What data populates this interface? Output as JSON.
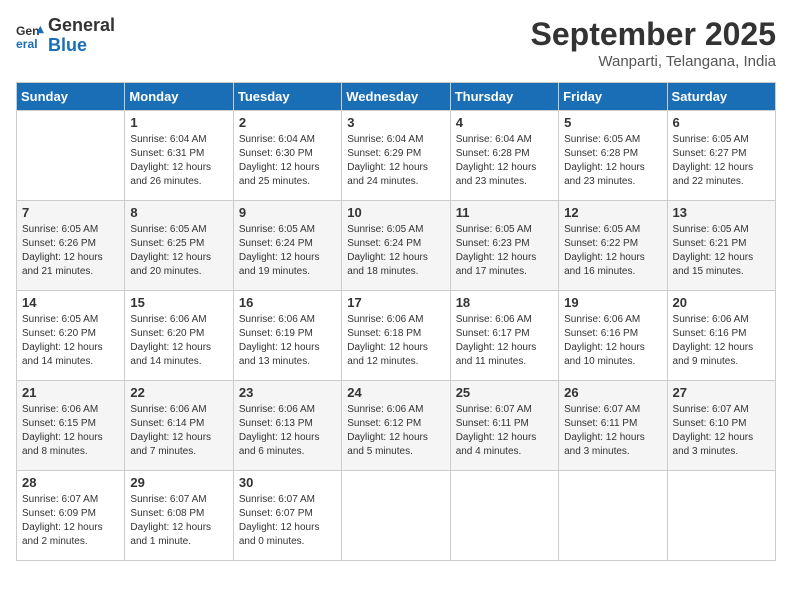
{
  "logo": {
    "line1": "General",
    "line2": "Blue"
  },
  "title": "September 2025",
  "subtitle": "Wanparti, Telangana, India",
  "days_of_week": [
    "Sunday",
    "Monday",
    "Tuesday",
    "Wednesday",
    "Thursday",
    "Friday",
    "Saturday"
  ],
  "weeks": [
    [
      {
        "day": "",
        "info": ""
      },
      {
        "day": "1",
        "info": "Sunrise: 6:04 AM\nSunset: 6:31 PM\nDaylight: 12 hours\nand 26 minutes."
      },
      {
        "day": "2",
        "info": "Sunrise: 6:04 AM\nSunset: 6:30 PM\nDaylight: 12 hours\nand 25 minutes."
      },
      {
        "day": "3",
        "info": "Sunrise: 6:04 AM\nSunset: 6:29 PM\nDaylight: 12 hours\nand 24 minutes."
      },
      {
        "day": "4",
        "info": "Sunrise: 6:04 AM\nSunset: 6:28 PM\nDaylight: 12 hours\nand 23 minutes."
      },
      {
        "day": "5",
        "info": "Sunrise: 6:05 AM\nSunset: 6:28 PM\nDaylight: 12 hours\nand 23 minutes."
      },
      {
        "day": "6",
        "info": "Sunrise: 6:05 AM\nSunset: 6:27 PM\nDaylight: 12 hours\nand 22 minutes."
      }
    ],
    [
      {
        "day": "7",
        "info": "Sunrise: 6:05 AM\nSunset: 6:26 PM\nDaylight: 12 hours\nand 21 minutes."
      },
      {
        "day": "8",
        "info": "Sunrise: 6:05 AM\nSunset: 6:25 PM\nDaylight: 12 hours\nand 20 minutes."
      },
      {
        "day": "9",
        "info": "Sunrise: 6:05 AM\nSunset: 6:24 PM\nDaylight: 12 hours\nand 19 minutes."
      },
      {
        "day": "10",
        "info": "Sunrise: 6:05 AM\nSunset: 6:24 PM\nDaylight: 12 hours\nand 18 minutes."
      },
      {
        "day": "11",
        "info": "Sunrise: 6:05 AM\nSunset: 6:23 PM\nDaylight: 12 hours\nand 17 minutes."
      },
      {
        "day": "12",
        "info": "Sunrise: 6:05 AM\nSunset: 6:22 PM\nDaylight: 12 hours\nand 16 minutes."
      },
      {
        "day": "13",
        "info": "Sunrise: 6:05 AM\nSunset: 6:21 PM\nDaylight: 12 hours\nand 15 minutes."
      }
    ],
    [
      {
        "day": "14",
        "info": "Sunrise: 6:05 AM\nSunset: 6:20 PM\nDaylight: 12 hours\nand 14 minutes."
      },
      {
        "day": "15",
        "info": "Sunrise: 6:06 AM\nSunset: 6:20 PM\nDaylight: 12 hours\nand 14 minutes."
      },
      {
        "day": "16",
        "info": "Sunrise: 6:06 AM\nSunset: 6:19 PM\nDaylight: 12 hours\nand 13 minutes."
      },
      {
        "day": "17",
        "info": "Sunrise: 6:06 AM\nSunset: 6:18 PM\nDaylight: 12 hours\nand 12 minutes."
      },
      {
        "day": "18",
        "info": "Sunrise: 6:06 AM\nSunset: 6:17 PM\nDaylight: 12 hours\nand 11 minutes."
      },
      {
        "day": "19",
        "info": "Sunrise: 6:06 AM\nSunset: 6:16 PM\nDaylight: 12 hours\nand 10 minutes."
      },
      {
        "day": "20",
        "info": "Sunrise: 6:06 AM\nSunset: 6:16 PM\nDaylight: 12 hours\nand 9 minutes."
      }
    ],
    [
      {
        "day": "21",
        "info": "Sunrise: 6:06 AM\nSunset: 6:15 PM\nDaylight: 12 hours\nand 8 minutes."
      },
      {
        "day": "22",
        "info": "Sunrise: 6:06 AM\nSunset: 6:14 PM\nDaylight: 12 hours\nand 7 minutes."
      },
      {
        "day": "23",
        "info": "Sunrise: 6:06 AM\nSunset: 6:13 PM\nDaylight: 12 hours\nand 6 minutes."
      },
      {
        "day": "24",
        "info": "Sunrise: 6:06 AM\nSunset: 6:12 PM\nDaylight: 12 hours\nand 5 minutes."
      },
      {
        "day": "25",
        "info": "Sunrise: 6:07 AM\nSunset: 6:11 PM\nDaylight: 12 hours\nand 4 minutes."
      },
      {
        "day": "26",
        "info": "Sunrise: 6:07 AM\nSunset: 6:11 PM\nDaylight: 12 hours\nand 3 minutes."
      },
      {
        "day": "27",
        "info": "Sunrise: 6:07 AM\nSunset: 6:10 PM\nDaylight: 12 hours\nand 3 minutes."
      }
    ],
    [
      {
        "day": "28",
        "info": "Sunrise: 6:07 AM\nSunset: 6:09 PM\nDaylight: 12 hours\nand 2 minutes."
      },
      {
        "day": "29",
        "info": "Sunrise: 6:07 AM\nSunset: 6:08 PM\nDaylight: 12 hours\nand 1 minute."
      },
      {
        "day": "30",
        "info": "Sunrise: 6:07 AM\nSunset: 6:07 PM\nDaylight: 12 hours\nand 0 minutes."
      },
      {
        "day": "",
        "info": ""
      },
      {
        "day": "",
        "info": ""
      },
      {
        "day": "",
        "info": ""
      },
      {
        "day": "",
        "info": ""
      }
    ]
  ]
}
